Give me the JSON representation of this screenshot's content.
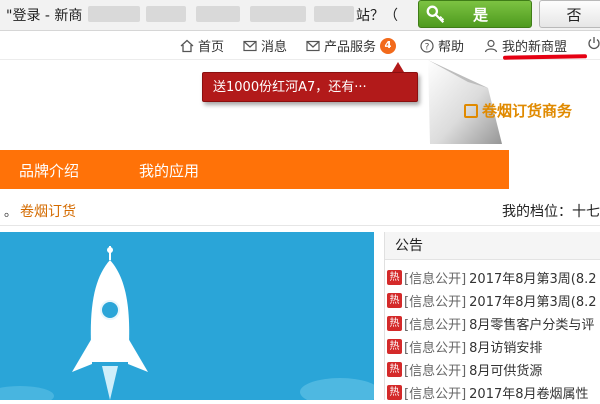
{
  "dialog": {
    "message": "\"登录 - 新商",
    "message_tail": "站？（",
    "yes_label": "是",
    "no_label": "否"
  },
  "topnav": {
    "items": [
      {
        "label": "首页",
        "icon": "home-icon"
      },
      {
        "label": "消息",
        "icon": "mail-icon"
      },
      {
        "label": "产品服务",
        "icon": "mail-icon",
        "badge": "4"
      },
      {
        "label": "帮助",
        "icon": "help-icon"
      },
      {
        "label": "我的新商盟",
        "icon": "user-icon"
      }
    ]
  },
  "tooltip": {
    "text": "送1000份红河A7，还有···"
  },
  "brand": {
    "text": "卷烟订货商务"
  },
  "menu": {
    "items": [
      "品牌介绍",
      "我的应用"
    ]
  },
  "crumbs": {
    "dot": "。",
    "current": "卷烟订货",
    "level": "我的档位：十七"
  },
  "notice": {
    "title": "公告",
    "hot_label": "热",
    "items": [
      {
        "category": "[信息公开]",
        "text": "2017年8月第3周(8.2"
      },
      {
        "category": "[信息公开]",
        "text": "2017年8月第3周(8.2"
      },
      {
        "category": "[信息公开]",
        "text": "8月零售客户分类与评"
      },
      {
        "category": "[信息公开]",
        "text": "8月访销安排"
      },
      {
        "category": "[信息公开]",
        "text": "8月可供货源"
      },
      {
        "category": "[信息公开]",
        "text": "2017年8月卷烟属性"
      }
    ]
  },
  "colors": {
    "orange_menu": "#ff7208",
    "tooltip_red": "#b21a1a",
    "hero_blue": "#2aa5d8",
    "yes_green": "#5aa826",
    "badge_orange": "#f26a1b"
  }
}
